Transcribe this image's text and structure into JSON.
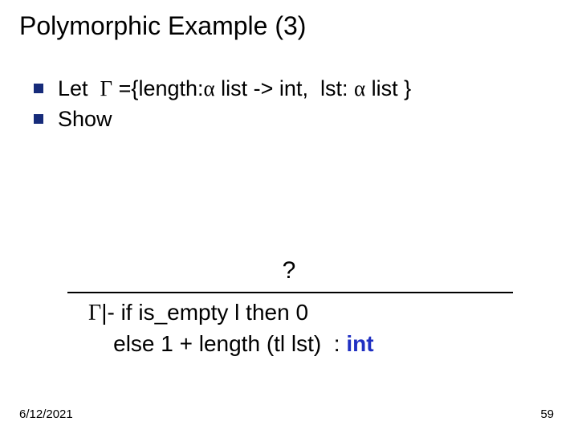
{
  "title": "Polymorphic Example (3)",
  "bullets": {
    "b1": {
      "prefix": "Let  ",
      "gamma": "Γ",
      "mid": " ={length:",
      "alpha1": "α",
      "mid2": " list -> int,  lst: ",
      "alpha2": "α",
      "suffix": " list }"
    },
    "b2": "Show"
  },
  "question": "?",
  "conclusion": {
    "gamma": "Γ",
    "line1_rest": "|- if is_empty l then 0",
    "line2_prefix": "    else 1 + length (tl lst)  : ",
    "int": "int"
  },
  "footer": {
    "date": "6/12/2021",
    "page": "59"
  },
  "chart_data": {
    "type": "table",
    "title": "Type derivation slide",
    "context": "Γ = { length: α list -> int, lst: α list }",
    "goal": "Γ |- if is_empty l then 0 else 1 + length (tl lst) : int",
    "premise": "?"
  }
}
